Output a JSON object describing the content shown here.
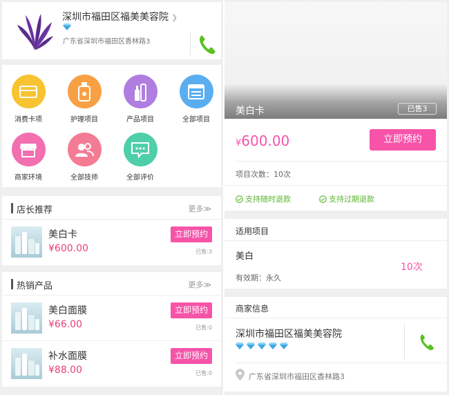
{
  "shop": {
    "name": "深圳市福田区福美美容院",
    "address": "广东省深圳市福田区香林路3"
  },
  "categories": [
    {
      "label": "消费卡项",
      "icon": "card-icon",
      "color": "#f8c331"
    },
    {
      "label": "护理项目",
      "icon": "bottle-icon",
      "color": "#f8a044"
    },
    {
      "label": "产品项目",
      "icon": "cosmetics-icon",
      "color": "#b07ee0"
    },
    {
      "label": "全部项目",
      "icon": "list-window-icon",
      "color": "#5aaef0"
    },
    {
      "label": "商家环境",
      "icon": "storefront-icon",
      "color": "#f26fb0"
    },
    {
      "label": "全部技师",
      "icon": "people-icon",
      "color": "#f37c94"
    },
    {
      "label": "全部评价",
      "icon": "comment-icon",
      "color": "#4fcfa9"
    }
  ],
  "recommend": {
    "title": "店长推荐",
    "more": "更多≫",
    "items": [
      {
        "name": "美白卡",
        "price": "¥600.00",
        "button": "立即预约",
        "sold": "已售:3"
      }
    ]
  },
  "hot": {
    "title": "热销产品",
    "more": "更多≫",
    "items": [
      {
        "name": "美白面膜",
        "price": "¥66.00",
        "button": "立即预约",
        "sold": "已售:0"
      },
      {
        "name": "补水面膜",
        "price": "¥88.00",
        "button": "立即预约",
        "sold": "已售:0"
      }
    ]
  },
  "detail": {
    "title": "美白卡",
    "sold_badge": "已售3",
    "currency": "¥",
    "price": "600.00",
    "book": "立即预约",
    "count": "项目次数：10次",
    "refund_anytime": "支持随时退款",
    "refund_expired": "支持过期退款"
  },
  "apply": {
    "heading": "适用项目",
    "name": "美白",
    "valid": "有效期：永久",
    "times": "10次"
  },
  "merchant": {
    "heading": "商家信息",
    "name": "深圳市福田区福美美容院",
    "gem_count": 5,
    "address": "广东省深圳市福田区香林路3"
  }
}
